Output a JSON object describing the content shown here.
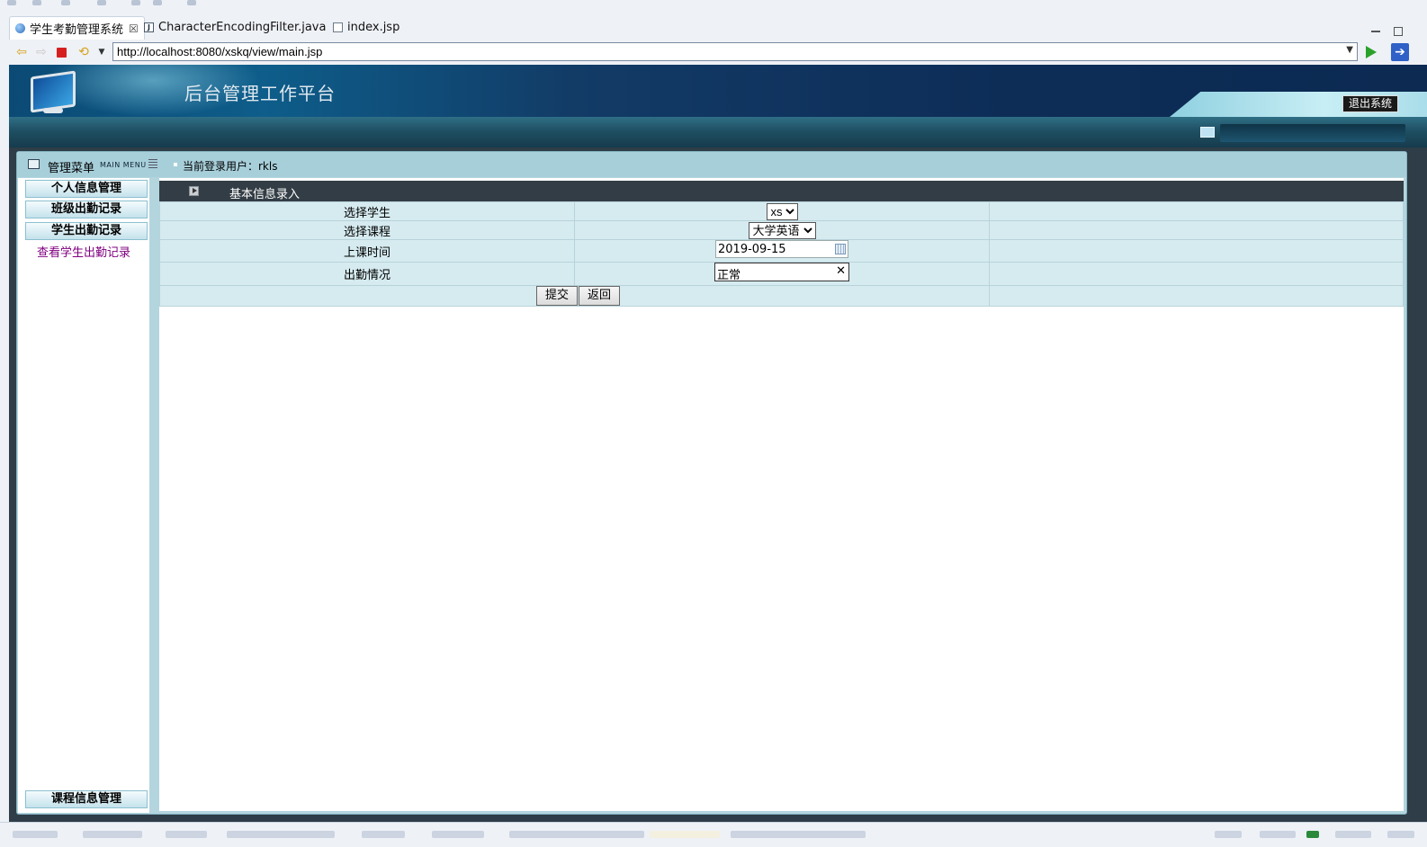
{
  "ide": {
    "tabs": [
      {
        "label": "学生考勤管理系统",
        "active": true,
        "icon": "globe-icon"
      },
      {
        "label": "CharacterEncodingFilter.java",
        "active": false,
        "icon": "java-file-icon"
      },
      {
        "label": "index.jsp",
        "active": false,
        "icon": "jsp-file-icon"
      }
    ],
    "close_glyph": "☒",
    "url": "http://localhost:8080/xskq/view/main.jsp"
  },
  "header": {
    "title": "后台管理工作平台",
    "logout_label": "退出系统"
  },
  "menu": {
    "title": "管理菜单",
    "subtitle": "MAIN MENU",
    "items": [
      "个人信息管理",
      "班级出勤记录",
      "学生出勤记录"
    ],
    "sublink": "查看学生出勤记录",
    "bottom_item": "课程信息管理"
  },
  "user": {
    "label": "当前登录用户：rkls"
  },
  "form": {
    "panel_title": "基本信息录入",
    "student_label": "选择学生",
    "student_value": "xs",
    "course_label": "选择课程",
    "course_value": "大学英语",
    "time_label": "上课时间",
    "time_value": "2019-09-15",
    "attendance_label": "出勤情况",
    "attendance_value": "正常",
    "submit_label": "提交",
    "back_label": "返回"
  },
  "colors": {
    "banner": "#0d2d57",
    "panel_head": "#333d45",
    "form_cell": "#d6ebf0",
    "visited_link": "#800080"
  }
}
